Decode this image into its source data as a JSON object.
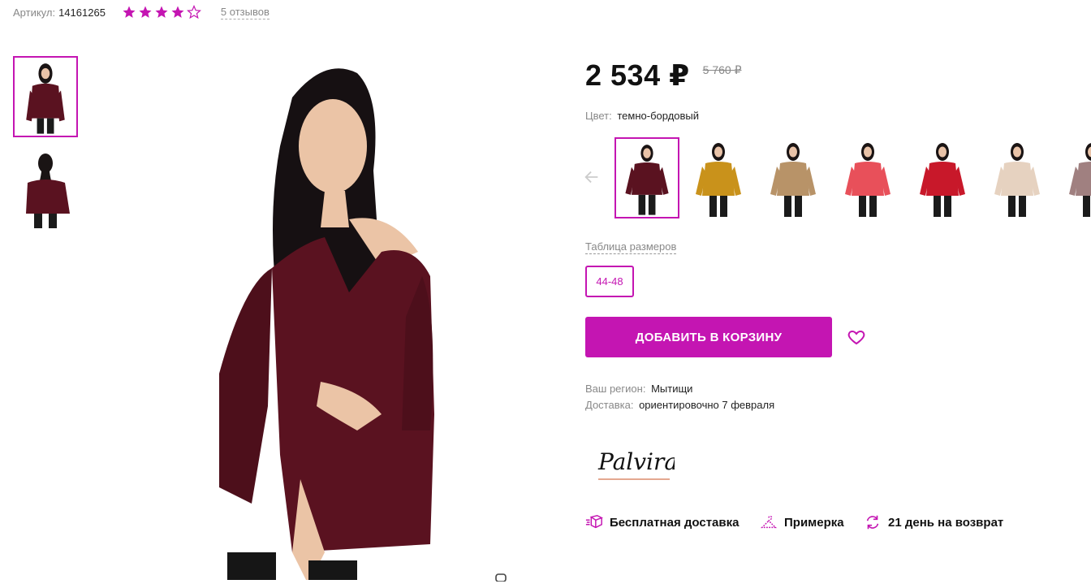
{
  "product": {
    "sku_label": "Артикул:",
    "sku_value": "14161265",
    "rating": 4,
    "rating_max": 5,
    "reviews_label": "5 отзывов",
    "price": "2 534 ₽",
    "old_price": "5 760 ₽",
    "color_label": "Цвет:",
    "color_value": "темно-бордовый",
    "size_table_label": "Таблица размеров",
    "sizes": [
      "44-48"
    ],
    "add_to_cart_label": "ДОБАВИТЬ В КОРЗИНУ",
    "region_label": "Ваш регион:",
    "region_value": "Мытищи",
    "delivery_label": "Доставка:",
    "delivery_value": "ориентировочно 7 февраля",
    "brand_logo_text": "Palvira"
  },
  "features": [
    {
      "label": "Бесплатная доставка",
      "icon": "box-icon"
    },
    {
      "label": "Примерка",
      "icon": "hanger-icon"
    },
    {
      "label": "21 день на возврат",
      "icon": "return-icon"
    }
  ],
  "colors": {
    "accent": "#c415b2",
    "swatches": [
      "#5a1220",
      "#c9921b",
      "#b89368",
      "#e8505a",
      "#c8182a",
      "#e6d2c0",
      "#a08080"
    ]
  }
}
